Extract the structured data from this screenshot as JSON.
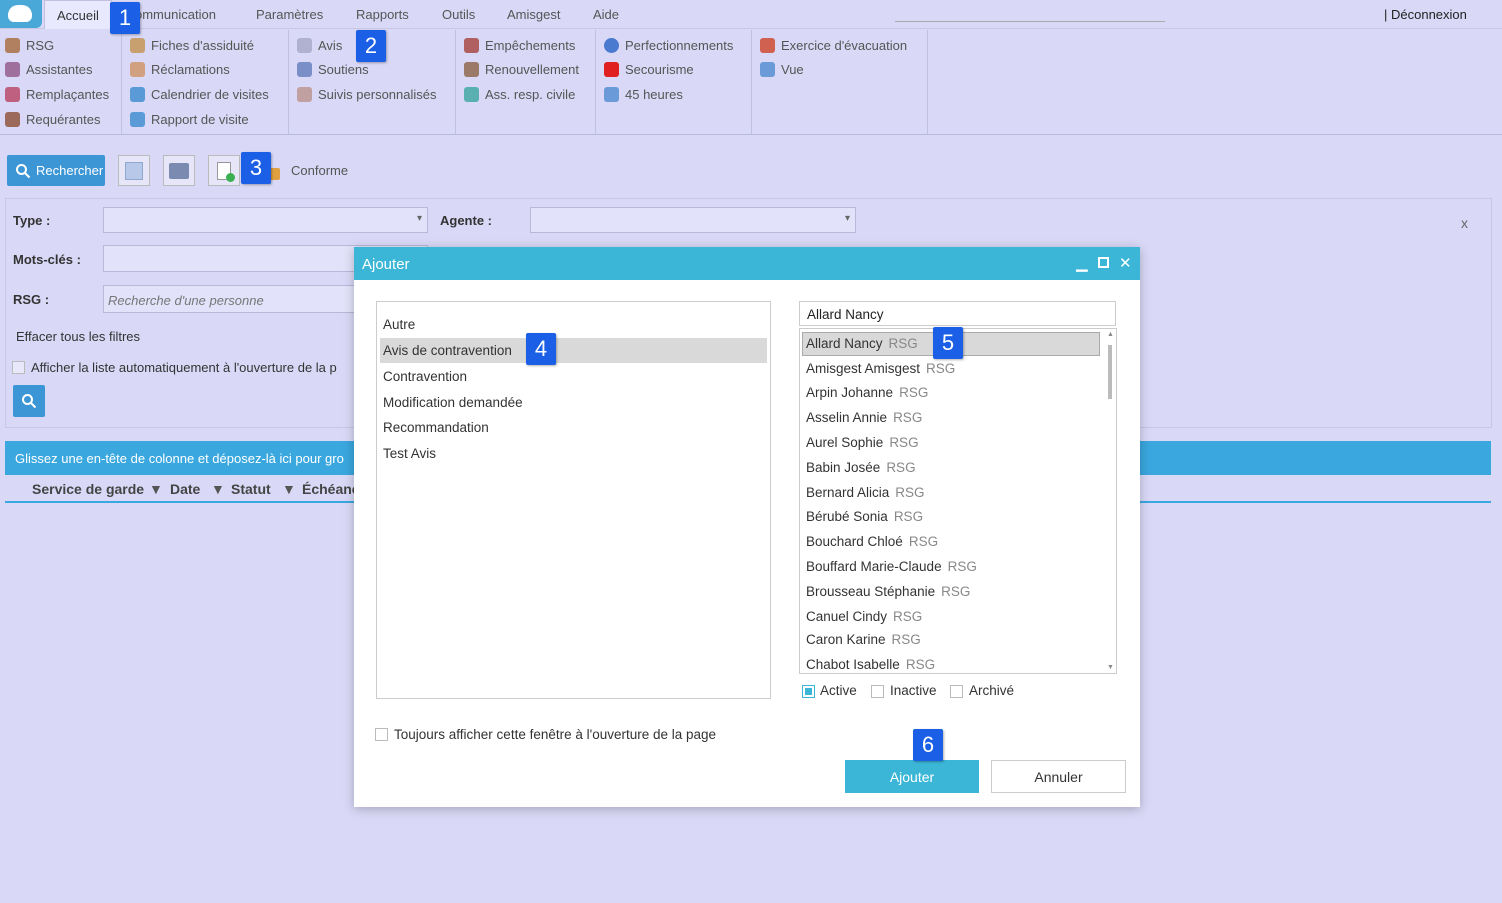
{
  "menu": {
    "items": [
      "Accueil",
      "ommunication",
      "Paramètres",
      "Rapports",
      "Outils",
      "Amisgest",
      "Aide"
    ],
    "logout": "|  Déconnexion"
  },
  "ribbon": {
    "col1": [
      "RSG",
      "Assistantes",
      "Remplaçantes",
      "Requérantes"
    ],
    "col2": [
      "Fiches d'assiduité",
      "Réclamations",
      "Calendrier de visites",
      "Rapport de visite"
    ],
    "col3": [
      "Avis",
      "Soutiens",
      "Suivis personnalisés"
    ],
    "col4": [
      "Empêchements",
      "Renouvellement",
      "Ass. resp. civile"
    ],
    "col5": [
      "Perfectionnements",
      "Secourisme",
      "45 heures"
    ],
    "col6": [
      "Exercice d'évacuation",
      "Vue"
    ]
  },
  "toolbar": {
    "search_label": "Rechercher",
    "conforme": "Conforme"
  },
  "filters": {
    "type_label": "Type :",
    "agente_label": "Agente :",
    "keywords_label": "Mots-clés :",
    "rsg_label": "RSG :",
    "rsg_placeholder": "Recherche d'une personne",
    "clear": "Effacer tous les filtres",
    "auto_show": "Afficher la liste automatiquement à l'ouverture de la p",
    "close": "x"
  },
  "grid": {
    "group_hint": "Glissez une en-tête de colonne et déposez-là ici pour gro",
    "columns": [
      "Service de garde",
      "Date",
      "Statut",
      "Échéanc"
    ]
  },
  "dialog": {
    "title": "Ajouter",
    "types": [
      "Autre",
      "Avis de contravention",
      "Contravention",
      "Modification demandée",
      "Recommandation",
      "Test Avis"
    ],
    "person_value": "Allard Nancy",
    "persons": [
      {
        "name": "Allard Nancy",
        "tag": "RSG"
      },
      {
        "name": "Amisgest Amisgest",
        "tag": "RSG"
      },
      {
        "name": "Arpin Johanne",
        "tag": "RSG"
      },
      {
        "name": "Asselin Annie",
        "tag": "RSG"
      },
      {
        "name": "Aurel Sophie",
        "tag": "RSG"
      },
      {
        "name": "Babin Josée",
        "tag": "RSG"
      },
      {
        "name": "Bernard Alicia",
        "tag": "RSG"
      },
      {
        "name": "Bérubé Sonia",
        "tag": "RSG"
      },
      {
        "name": "Bouchard Chloé",
        "tag": "RSG"
      },
      {
        "name": "Bouffard Marie-Claude",
        "tag": "RSG"
      },
      {
        "name": "Brousseau Stéphanie",
        "tag": "RSG"
      },
      {
        "name": "Canuel Cindy",
        "tag": "RSG"
      },
      {
        "name": "Caron Karine",
        "tag": "RSG"
      },
      {
        "name": "Chabot Isabelle",
        "tag": "RSG"
      }
    ],
    "status_filters": [
      "Active",
      "Inactive",
      "Archivé"
    ],
    "always_show": "Toujours afficher cette fenêtre à l'ouverture de la page",
    "ok": "Ajouter",
    "cancel": "Annuler"
  },
  "callouts": [
    "1",
    "2",
    "3",
    "4",
    "5",
    "6"
  ],
  "colors": {
    "accent": "#3bb6d6",
    "callout": "#1a5fe6",
    "background": "#d9d9f7"
  }
}
